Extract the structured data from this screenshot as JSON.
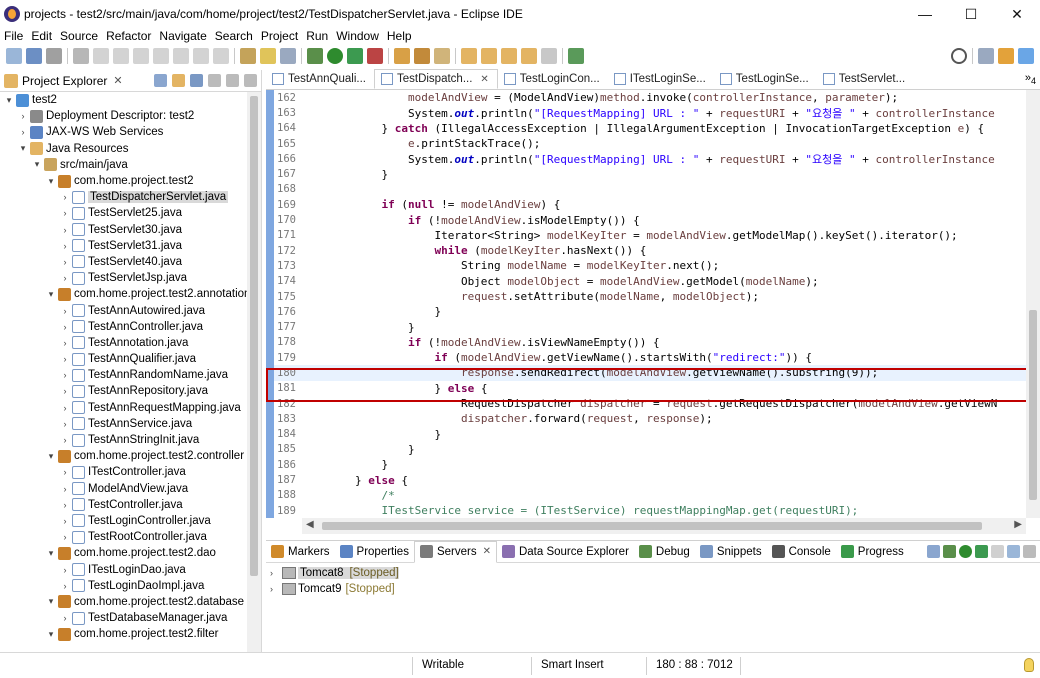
{
  "window": {
    "title": "projects - test2/src/main/java/com/home/project/test2/TestDispatcherServlet.java - Eclipse IDE",
    "minimize": "—",
    "maximize": "☐",
    "close": "✕"
  },
  "menu": [
    "File",
    "Edit",
    "Source",
    "Refactor",
    "Navigate",
    "Search",
    "Project",
    "Run",
    "Window",
    "Help"
  ],
  "explorer": {
    "title": "Project Explorer",
    "close": "✕",
    "tree": [
      {
        "label": "test2",
        "arrow": "▾",
        "icon": "project",
        "indent": 0
      },
      {
        "label": "Deployment Descriptor: test2",
        "arrow": "›",
        "icon": "desc",
        "indent": 1
      },
      {
        "label": "JAX-WS Web Services",
        "arrow": "›",
        "icon": "ws",
        "indent": 1
      },
      {
        "label": "Java Resources",
        "arrow": "▾",
        "icon": "res",
        "indent": 1
      },
      {
        "label": "src/main/java",
        "arrow": "▾",
        "icon": "src",
        "indent": 2
      },
      {
        "label": "com.home.project.test2",
        "arrow": "▾",
        "icon": "pkg",
        "indent": 3
      },
      {
        "label": "TestDispatcherServlet.java",
        "arrow": "›",
        "icon": "java",
        "indent": 4,
        "selected": true
      },
      {
        "label": "TestServlet25.java",
        "arrow": "›",
        "icon": "java",
        "indent": 4
      },
      {
        "label": "TestServlet30.java",
        "arrow": "›",
        "icon": "java",
        "indent": 4
      },
      {
        "label": "TestServlet31.java",
        "arrow": "›",
        "icon": "java",
        "indent": 4
      },
      {
        "label": "TestServlet40.java",
        "arrow": "›",
        "icon": "java",
        "indent": 4
      },
      {
        "label": "TestServletJsp.java",
        "arrow": "›",
        "icon": "java",
        "indent": 4
      },
      {
        "label": "com.home.project.test2.annotation",
        "arrow": "▾",
        "icon": "pkg",
        "indent": 3
      },
      {
        "label": "TestAnnAutowired.java",
        "arrow": "›",
        "icon": "java",
        "indent": 4
      },
      {
        "label": "TestAnnController.java",
        "arrow": "›",
        "icon": "java",
        "indent": 4
      },
      {
        "label": "TestAnnotation.java",
        "arrow": "›",
        "icon": "java",
        "indent": 4
      },
      {
        "label": "TestAnnQualifier.java",
        "arrow": "›",
        "icon": "java",
        "indent": 4
      },
      {
        "label": "TestAnnRandomName.java",
        "arrow": "›",
        "icon": "java",
        "indent": 4
      },
      {
        "label": "TestAnnRepository.java",
        "arrow": "›",
        "icon": "java",
        "indent": 4
      },
      {
        "label": "TestAnnRequestMapping.java",
        "arrow": "›",
        "icon": "java",
        "indent": 4
      },
      {
        "label": "TestAnnService.java",
        "arrow": "›",
        "icon": "java",
        "indent": 4
      },
      {
        "label": "TestAnnStringInit.java",
        "arrow": "›",
        "icon": "java",
        "indent": 4
      },
      {
        "label": "com.home.project.test2.controller",
        "arrow": "▾",
        "icon": "pkg",
        "indent": 3
      },
      {
        "label": "ITestController.java",
        "arrow": "›",
        "icon": "java",
        "indent": 4
      },
      {
        "label": "ModelAndView.java",
        "arrow": "›",
        "icon": "java",
        "indent": 4
      },
      {
        "label": "TestController.java",
        "arrow": "›",
        "icon": "java",
        "indent": 4
      },
      {
        "label": "TestLoginController.java",
        "arrow": "›",
        "icon": "java",
        "indent": 4
      },
      {
        "label": "TestRootController.java",
        "arrow": "›",
        "icon": "java",
        "indent": 4
      },
      {
        "label": "com.home.project.test2.dao",
        "arrow": "▾",
        "icon": "pkg",
        "indent": 3
      },
      {
        "label": "ITestLoginDao.java",
        "arrow": "›",
        "icon": "java",
        "indent": 4
      },
      {
        "label": "TestLoginDaoImpl.java",
        "arrow": "›",
        "icon": "java",
        "indent": 4
      },
      {
        "label": "com.home.project.test2.database",
        "arrow": "▾",
        "icon": "pkg",
        "indent": 3
      },
      {
        "label": "TestDatabaseManager.java",
        "arrow": "›",
        "icon": "java",
        "indent": 4
      },
      {
        "label": "com.home.project.test2.filter",
        "arrow": "▾",
        "icon": "pkg",
        "indent": 3
      }
    ]
  },
  "editor": {
    "tabs": [
      {
        "label": "TestAnnQuali...",
        "active": false
      },
      {
        "label": "TestDispatch...",
        "active": true
      },
      {
        "label": "TestLoginCon...",
        "active": false
      },
      {
        "label": "ITestLoginSe...",
        "active": false
      },
      {
        "label": "TestLoginSe...",
        "active": false
      },
      {
        "label": "TestServlet...",
        "active": false
      }
    ],
    "more": "»",
    "more_count": "4",
    "lines": [
      {
        "n": "162",
        "html": "                <span class=\"vr\">modelAndView</span> = (ModelAndView)<span class=\"vr\">method</span>.invoke(<span class=\"vr\">controllerInstance</span>, <span class=\"vr\">parameter</span>);"
      },
      {
        "n": "163",
        "html": "                System.<span class=\"sfld\">out</span>.println(<span class=\"str\">\"[RequestMapping] URL : \"</span> + <span class=\"vr\">requestURI</span> + <span class=\"str\">\"요청을 \"</span> + <span class=\"vr\">controllerInstance</span>"
      },
      {
        "n": "164",
        "html": "            } <span class=\"kw\">catch</span> (IllegalAccessException | IllegalArgumentException | InvocationTargetException <span class=\"vr\">e</span>) {"
      },
      {
        "n": "165",
        "html": "                <span class=\"vr\">e</span>.printStackTrace();"
      },
      {
        "n": "166",
        "html": "                System.<span class=\"sfld\">out</span>.println(<span class=\"str\">\"[RequestMapping] URL : \"</span> + <span class=\"vr\">requestURI</span> + <span class=\"str\">\"요청을 \"</span> + <span class=\"vr\">controllerInstance</span>"
      },
      {
        "n": "167",
        "html": "            }"
      },
      {
        "n": "168",
        "html": ""
      },
      {
        "n": "169",
        "html": "            <span class=\"kw\">if</span> (<span class=\"kw\">null</span> != <span class=\"vr\">modelAndView</span>) {"
      },
      {
        "n": "170",
        "html": "                <span class=\"kw\">if</span> (!<span class=\"vr\">modelAndView</span>.isModelEmpty()) {"
      },
      {
        "n": "171",
        "html": "                    Iterator&lt;String&gt; <span class=\"vr\">modelKeyIter</span> = <span class=\"vr\">modelAndView</span>.getModelMap().keySet().iterator();"
      },
      {
        "n": "172",
        "html": "                    <span class=\"kw\">while</span> (<span class=\"vr\">modelKeyIter</span>.hasNext()) {"
      },
      {
        "n": "173",
        "html": "                        String <span class=\"vr\">modelName</span> = <span class=\"vr\">modelKeyIter</span>.next();"
      },
      {
        "n": "174",
        "html": "                        Object <span class=\"vr\">modelObject</span> = <span class=\"vr\">modelAndView</span>.getModel(<span class=\"vr\">modelName</span>);"
      },
      {
        "n": "175",
        "html": "                        <span class=\"vr\">request</span>.setAttribute(<span class=\"vr\">modelName</span>, <span class=\"vr\">modelObject</span>);"
      },
      {
        "n": "176",
        "html": "                    }"
      },
      {
        "n": "177",
        "html": "                }"
      },
      {
        "n": "178",
        "html": "                <span class=\"kw\">if</span> (!<span class=\"vr\">modelAndView</span>.isViewNameEmpty()) {"
      },
      {
        "n": "179",
        "html": "                    <span class=\"kw\">if</span> (<span class=\"vr\">modelAndView</span>.getViewName().startsWith(<span class=\"str\">\"redirect:\"</span>)) {"
      },
      {
        "n": "180",
        "html": "                        <span class=\"vr\">response</span>.sendRedirect(<span class=\"vr\">modelAndView</span>.getViewName().substring(9));",
        "current": true
      },
      {
        "n": "181",
        "html": "                    } <span class=\"kw\">else</span> {"
      },
      {
        "n": "182",
        "html": "                        RequestDispatcher <span class=\"vr\">dispatcher</span> = <span class=\"vr\">request</span>.getRequestDispatcher(<span class=\"vr\">modelAndView</span>.getViewN"
      },
      {
        "n": "183",
        "html": "                        <span class=\"vr\">dispatcher</span>.forward(<span class=\"vr\">request</span>, <span class=\"vr\">response</span>);"
      },
      {
        "n": "184",
        "html": "                    }"
      },
      {
        "n": "185",
        "html": "                }"
      },
      {
        "n": "186",
        "html": "            }"
      },
      {
        "n": "187",
        "html": "        } <span class=\"kw\">else</span> {"
      },
      {
        "n": "188",
        "html": "            <span class=\"cmt\">/*</span>"
      },
      {
        "n": "189",
        "html": "            <span class=\"cmt\">ITestService service = (ITestService) requestMappingMap.get(requestURI);</span>"
      }
    ]
  },
  "bottom": {
    "tabs": [
      {
        "label": "Markers",
        "color": "#d08a2a"
      },
      {
        "label": "Properties",
        "color": "#5b84c4"
      },
      {
        "label": "Servers",
        "color": "#7b7b7b",
        "active": true
      },
      {
        "label": "Data Source Explorer",
        "color": "#8a6fb0"
      },
      {
        "label": "Debug",
        "color": "#5a8f4a"
      },
      {
        "label": "Snippets",
        "color": "#7a98c4"
      },
      {
        "label": "Console",
        "color": "#555555"
      },
      {
        "label": "Progress",
        "color": "#3a9a4a"
      }
    ],
    "servers": [
      {
        "name": "Tomcat8",
        "status": "[Stopped]",
        "selected": true
      },
      {
        "name": "Tomcat9",
        "status": "[Stopped]",
        "selected": false
      }
    ]
  },
  "status": {
    "mode": "Writable",
    "insert": "Smart Insert",
    "position": "180 : 88 : 7012"
  },
  "colors": {
    "ruler": "#7fa7e0",
    "highlight_box": "#c00000",
    "keyword": "#7f0055",
    "string": "#2a00ff"
  }
}
